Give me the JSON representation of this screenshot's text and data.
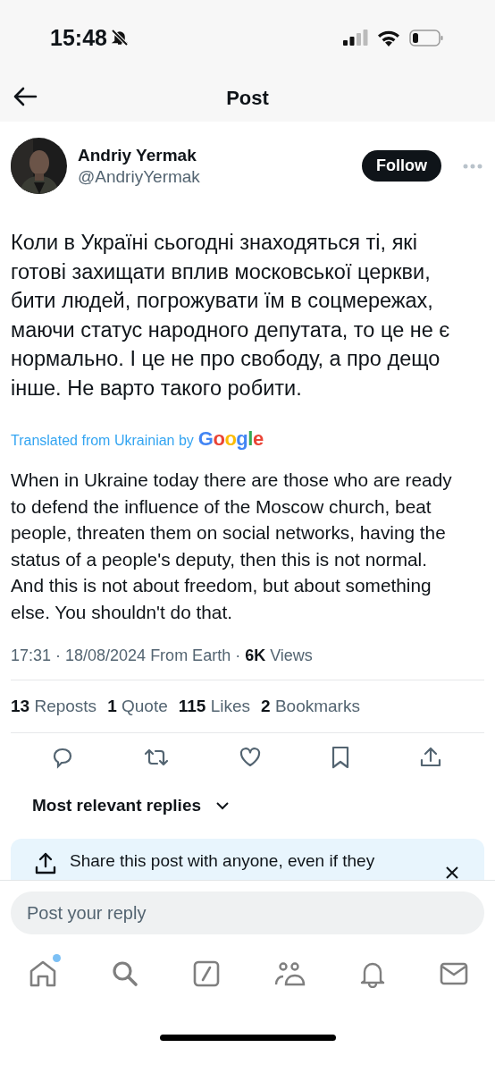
{
  "status_bar": {
    "time": "15:48",
    "muted": true
  },
  "header": {
    "title": "Post"
  },
  "author": {
    "name": "Andriy Yermak",
    "handle": "@AndriyYermak",
    "follow_label": "Follow"
  },
  "post": {
    "text": "Коли в Україні сьогодні знаходяться ті, які готові захищати вплив московської церкви, бити людей, погрожувати їм в соцмережах, маючи статус народного депутата, то це не є нормально. І це не про свободу, а про дещо інше. Не варто такого робити.",
    "translation_note": "Translated from Ukrainian by",
    "translation_brand": "Google",
    "translation": "When in Ukraine today there are those who are ready to defend the influence of the Moscow church, beat people, threaten them on social networks, having the status of a people's deputy, then this is not normal. And this is not about freedom, but about something else. You shouldn't do that.",
    "meta": "17:31 · 18/08/2024 From Earth · **6K** Views"
  },
  "stats": [
    "**13** Reposts",
    "**1** Quote",
    "**115** Likes",
    "**2** Bookmarks"
  ],
  "actions": [
    {
      "kind": "reply"
    },
    {
      "kind": "repost"
    },
    {
      "kind": "like"
    },
    {
      "kind": "bookmark"
    },
    {
      "kind": "share"
    }
  ],
  "replies_sort": {
    "label": "Most relevant replies"
  },
  "share_tip": {
    "text": "Share this post with anyone, even if they"
  },
  "reply_field": {
    "placeholder": "Post your reply"
  },
  "nav": [
    {
      "kind": "home",
      "dot": true
    },
    {
      "kind": "search",
      "dot": false
    },
    {
      "kind": "compose",
      "dot": false
    },
    {
      "kind": "communities",
      "dot": false
    },
    {
      "kind": "notifications",
      "dot": false
    },
    {
      "kind": "messages",
      "dot": false
    }
  ]
}
